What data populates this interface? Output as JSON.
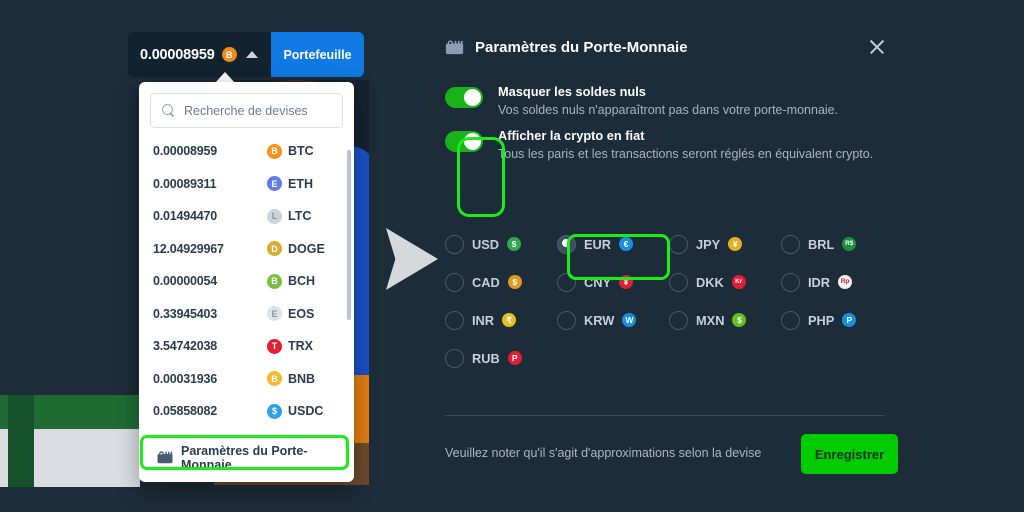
{
  "wallet_bar": {
    "balance": "0.00008959",
    "balance_coin": {
      "symbol": "B",
      "color": "#f08a1c"
    },
    "caret": "chevron-up",
    "wallet_button": "Portefeuille"
  },
  "dropdown": {
    "search_placeholder": "Recherche de devises",
    "coins": [
      {
        "value": "0.00008959",
        "symbol": "BTC",
        "glyph": "B",
        "color": "#f7931a"
      },
      {
        "value": "0.00089311",
        "symbol": "ETH",
        "glyph": "E",
        "color": "#6279e8"
      },
      {
        "value": "0.01494470",
        "symbol": "LTC",
        "glyph": "L",
        "color": "#cfd2d8"
      },
      {
        "value": "12.04929967",
        "symbol": "DOGE",
        "glyph": "D",
        "color": "#d4ad34"
      },
      {
        "value": "0.00000054",
        "symbol": "BCH",
        "glyph": "B",
        "color": "#7bc043"
      },
      {
        "value": "0.33945403",
        "symbol": "EOS",
        "glyph": "E",
        "color": "#dfe2e7"
      },
      {
        "value": "3.54742038",
        "symbol": "TRX",
        "glyph": "T",
        "color": "#e01f36"
      },
      {
        "value": "0.00031936",
        "symbol": "BNB",
        "glyph": "B",
        "color": "#f3ba2f"
      },
      {
        "value": "0.05858082",
        "symbol": "USDC",
        "glyph": "$",
        "color": "#2f9fe8"
      }
    ],
    "settings_item": "Paramètres du Porte-Monnaie"
  },
  "panel": {
    "title": "Paramètres du Porte-Monnaie",
    "close_label": "×",
    "toggles": [
      {
        "title": "Masquer les soldes nuls",
        "desc": "Vos soldes nuls n'apparaîtront pas dans votre porte-monnaie.",
        "on": true
      },
      {
        "title": "Afficher la crypto en fiat",
        "desc": "Tous les paris et les transactions seront réglés en équivalent crypto.",
        "on": true
      }
    ],
    "currencies": [
      {
        "code": "USD",
        "glyph": "$",
        "color": "#2fa84f",
        "selected": false
      },
      {
        "code": "EUR",
        "glyph": "€",
        "color": "#1a8fe0",
        "selected": true
      },
      {
        "code": "JPY",
        "glyph": "¥",
        "color": "#e0b020",
        "selected": false
      },
      {
        "code": "BRL",
        "glyph": "R$",
        "color": "#1e8f3c",
        "selected": false
      },
      {
        "code": "CAD",
        "glyph": "$",
        "color": "#e09a22",
        "selected": false
      },
      {
        "code": "CNY",
        "glyph": "¥",
        "color": "#e01f36",
        "selected": false
      },
      {
        "code": "DKK",
        "glyph": "Kr",
        "color": "#e01f36",
        "selected": false
      },
      {
        "code": "IDR",
        "glyph": "Rp",
        "color": "#f2f2f2",
        "selected": false
      },
      {
        "code": "INR",
        "glyph": "₹",
        "color": "#e0c022",
        "selected": false
      },
      {
        "code": "KRW",
        "glyph": "W",
        "color": "#1a8fe0",
        "selected": false
      },
      {
        "code": "MXN",
        "glyph": "$",
        "color": "#64c11a",
        "selected": false
      },
      {
        "code": "PHP",
        "glyph": "P",
        "color": "#1a8fe0",
        "selected": false
      },
      {
        "code": "RUB",
        "glyph": "P",
        "color": "#e01f36",
        "selected": false
      }
    ],
    "footer_note": "Veuillez noter qu'il s'agit d'approximations selon la devise",
    "save_button": "Enregistrer"
  },
  "colors": {
    "background": "#1d2c39",
    "accent_blue": "#1179e4",
    "accent_green": "#00cc00",
    "highlight_green": "#1aed1a"
  }
}
